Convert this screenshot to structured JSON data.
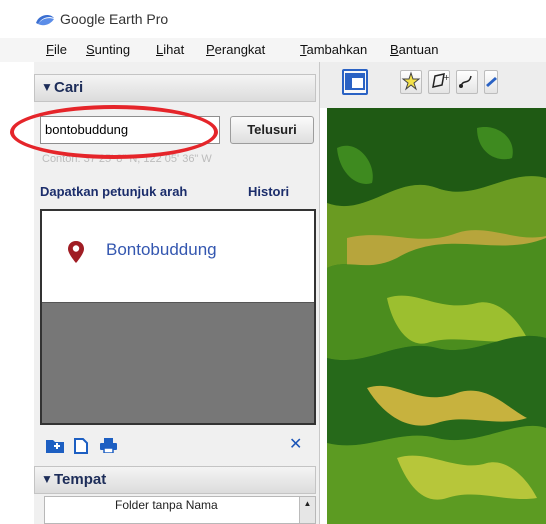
{
  "window": {
    "title": "Google Earth Pro"
  },
  "menu": [
    {
      "label": "File"
    },
    {
      "label": "Sunting"
    },
    {
      "label": "Lihat"
    },
    {
      "label": "Perangkat"
    },
    {
      "label": "Tambahkan"
    },
    {
      "label": "Bantuan"
    }
  ],
  "search": {
    "header": "Cari",
    "query": "bontobuddung",
    "button_label": "Telusuri",
    "coords": "Contoh: 37 25' 8\" N, 122 05' 36\" W",
    "directions_link": "Dapatkan petunjuk arah",
    "history_link": "Histori"
  },
  "results": [
    {
      "name": "Bontobuddung"
    }
  ],
  "places": {
    "header": "Tempat",
    "folder_label": "Folder tanpa Nama"
  },
  "colors": {
    "accent_blue": "#1d2d59",
    "link_blue": "#3457b0",
    "pin_red": "#a01d24",
    "highlight_red": "#e5252a"
  },
  "icons": [
    "google-earth-logo-icon",
    "sidebar-toggle-icon",
    "placemark-icon",
    "polygon-icon",
    "path-icon",
    "overlay-icon",
    "add-folder-icon",
    "copy-icon",
    "print-icon",
    "close-icon",
    "map-pin-icon"
  ]
}
